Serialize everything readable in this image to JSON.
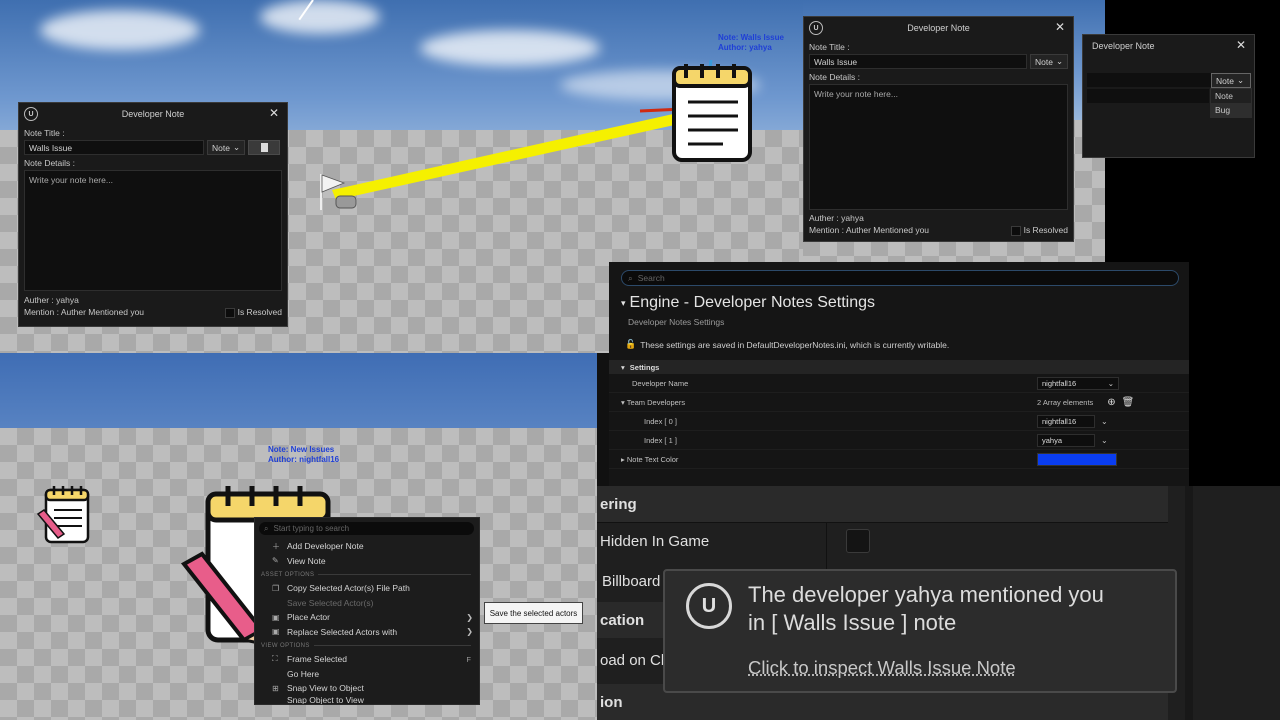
{
  "dialog1": {
    "title": "Developer Note",
    "note_title_label": "Note Title :",
    "note_title_value": "Walls Issue",
    "type_value": "Note",
    "details_label": "Note Details :",
    "details_placeholder": "Write your note here...",
    "author_text": "Auther : yahya",
    "mention_text": "Mention : Auther Mentioned you",
    "resolved_label": "Is Resolved"
  },
  "dialog2": {
    "title": "Developer Note",
    "note_title_label": "Note Title :",
    "note_title_value": "Walls Issue",
    "type_value": "Note",
    "details_label": "Note Details :",
    "details_placeholder": "Write your note here...",
    "author_text": "Auther : yahya",
    "mention_text": "Mention : Auther Mentioned you",
    "resolved_label": "Is Resolved"
  },
  "dialog3": {
    "title": "Developer Note",
    "type_value": "Note",
    "options": [
      "Note",
      "Bug"
    ]
  },
  "scene1": {
    "note_label_line1": "Note: Walls Issue",
    "note_label_line2": "Author: yahya"
  },
  "scene2": {
    "note_label_line1": "Note: New Issues",
    "note_label_line2": "Author: nightfall16"
  },
  "settings": {
    "search_placeholder": "Search",
    "title": "Engine - Developer Notes Settings",
    "subtitle": "Developer Notes Settings",
    "info": "These settings are saved in DefaultDeveloperNotes.ini, which is currently writable.",
    "category": "Settings",
    "developer_name_label": "Developer Name",
    "developer_name_value": "nightfall16",
    "team_label": "Team Developers",
    "team_count": "2 Array elements",
    "index0_label": "Index [ 0 ]",
    "index0_value": "nightfall16",
    "index1_label": "Index [ 1 ]",
    "index1_value": "yahya",
    "color_label": "Note Text Color",
    "color_value": "#0a3df0"
  },
  "context_menu": {
    "search_placeholder": "Start typing to search",
    "add_note": "Add Developer Note",
    "view_note": "View Note",
    "asset_section": "ASSET OPTIONS",
    "copy_path": "Copy Selected Actor(s) File Path",
    "save_selected": "Save Selected Actor(s)",
    "place_actor": "Place Actor",
    "replace_actors": "Replace Selected Actors with",
    "view_section": "VIEW OPTIONS",
    "frame_selected": "Frame Selected",
    "frame_shortcut": "F",
    "go_here": "Go Here",
    "snap_view": "Snap View to Object",
    "snap_object": "Snap Object to View"
  },
  "tooltip": "Save the selected actors",
  "details": {
    "row_rendering": "ering",
    "row_hidden": "Hidden In Game",
    "row_billboard": "Billboard",
    "row_location": "cation",
    "row_load": "oad on Cl",
    "row_ion": "ion"
  },
  "toast": {
    "title_line1": "The developer yahya mentioned you",
    "title_line2": "in [ Walls Issue ] note",
    "link": "Click to inspect Walls Issue Note"
  },
  "colors": {
    "arrow": "#f5f000",
    "note_label": "#1f3fd6",
    "accent": "#0a3df0"
  }
}
